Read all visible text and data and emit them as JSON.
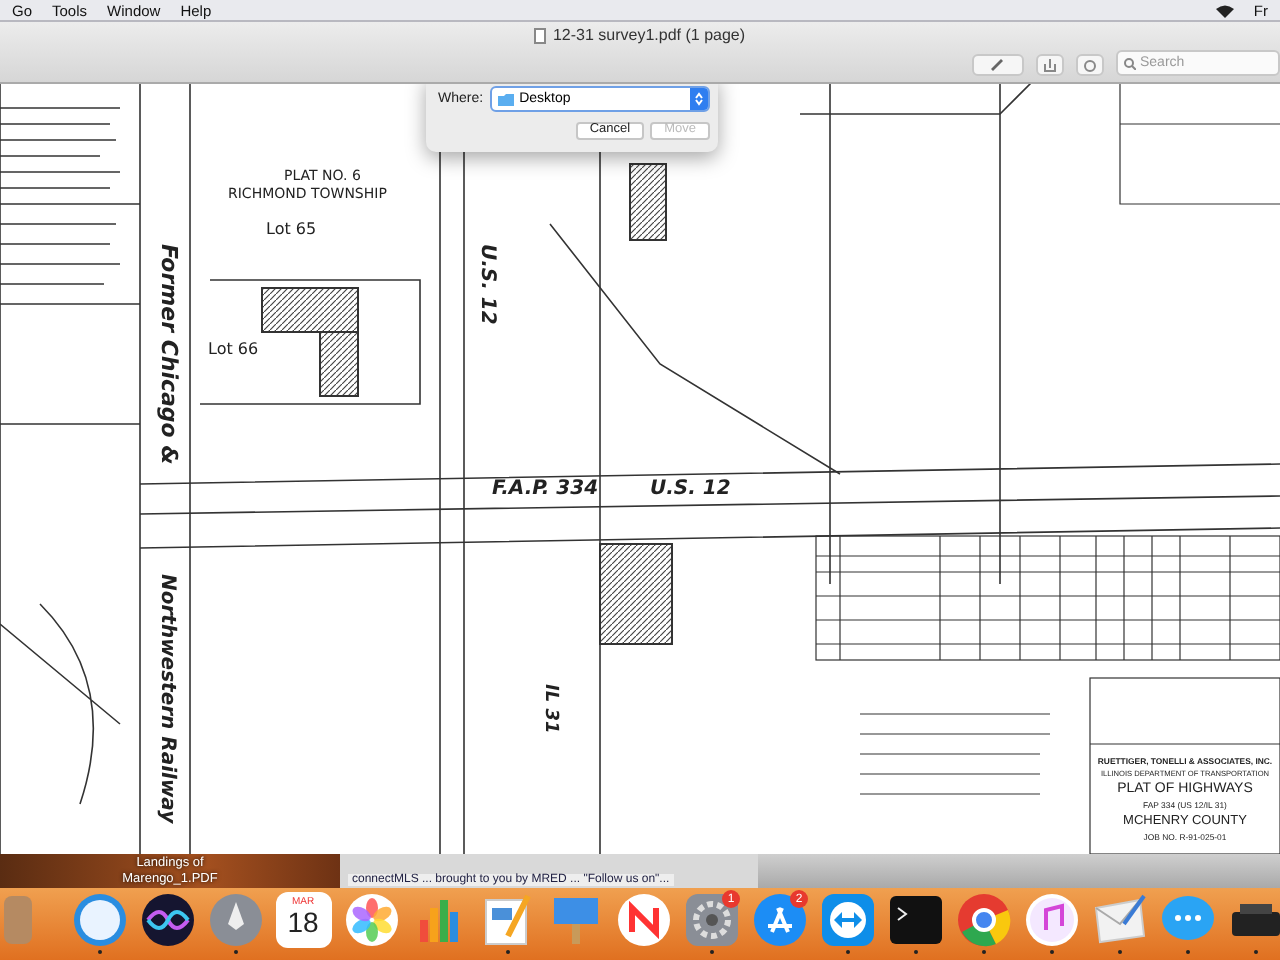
{
  "menu_bar": {
    "items": [
      "Go",
      "Tools",
      "Window",
      "Help"
    ],
    "clock": "Fr"
  },
  "window": {
    "title": "12-31 survey1.pdf (1 page)",
    "search": {
      "placeholder": "Search"
    }
  },
  "dialog": {
    "where_label": "Where:",
    "location": "Desktop",
    "buttons": [
      {
        "label": "Cancel",
        "disabled": false
      },
      {
        "label": "Move",
        "disabled": true
      }
    ]
  },
  "document": {
    "labels": [
      {
        "text": "PLAT NO. 6",
        "kind": "plain"
      },
      {
        "text": "RICHMOND TOWNSHIP",
        "kind": "plain"
      },
      {
        "text": "Lot 65",
        "kind": "plain"
      },
      {
        "text": "Lot 66",
        "kind": "plain"
      },
      {
        "text": "U.S. 12",
        "kind": "vertical-road"
      },
      {
        "text": "F.A.P. 334",
        "kind": "road"
      },
      {
        "text": "U.S. 12",
        "kind": "road"
      },
      {
        "text": "IL 31",
        "kind": "vertical-road"
      },
      {
        "text": "Former Chicago &",
        "kind": "vertical-rail"
      },
      {
        "text": "Northwestern Railway",
        "kind": "vertical-rail"
      }
    ],
    "title_block": [
      "RUETTIGER, TONELLI & ASSOCIATES, INC.",
      "ILLINOIS DEPARTMENT OF TRANSPORTATION",
      "PLAT OF HIGHWAYS",
      "FAP 334 (US 12/IL 31)",
      "MCHENRY COUNTY",
      "JOB NO. R-91-025-01"
    ]
  },
  "desktop_file": {
    "name": "Landings of Marengo_1.PDF"
  },
  "browser_strip": {
    "text": "connectMLS ... brought to you by MRED ... \"Follow us on\"..."
  },
  "dock": {
    "calendar": {
      "month": "MAR",
      "day": "18"
    },
    "items": [
      {
        "running": false
      },
      {
        "running": true
      },
      {
        "running": false
      },
      {
        "running": true
      },
      {
        "running": false
      },
      {
        "running": false
      },
      {
        "running": false
      },
      {
        "running": true
      },
      {
        "running": false
      },
      {
        "running": false
      },
      {
        "running": true,
        "badge": "1"
      },
      {
        "running": false,
        "badge": "2"
      },
      {
        "running": true
      },
      {
        "running": true
      },
      {
        "running": true
      },
      {
        "running": true
      },
      {
        "running": true
      },
      {
        "running": true
      },
      {
        "running": true
      }
    ]
  }
}
